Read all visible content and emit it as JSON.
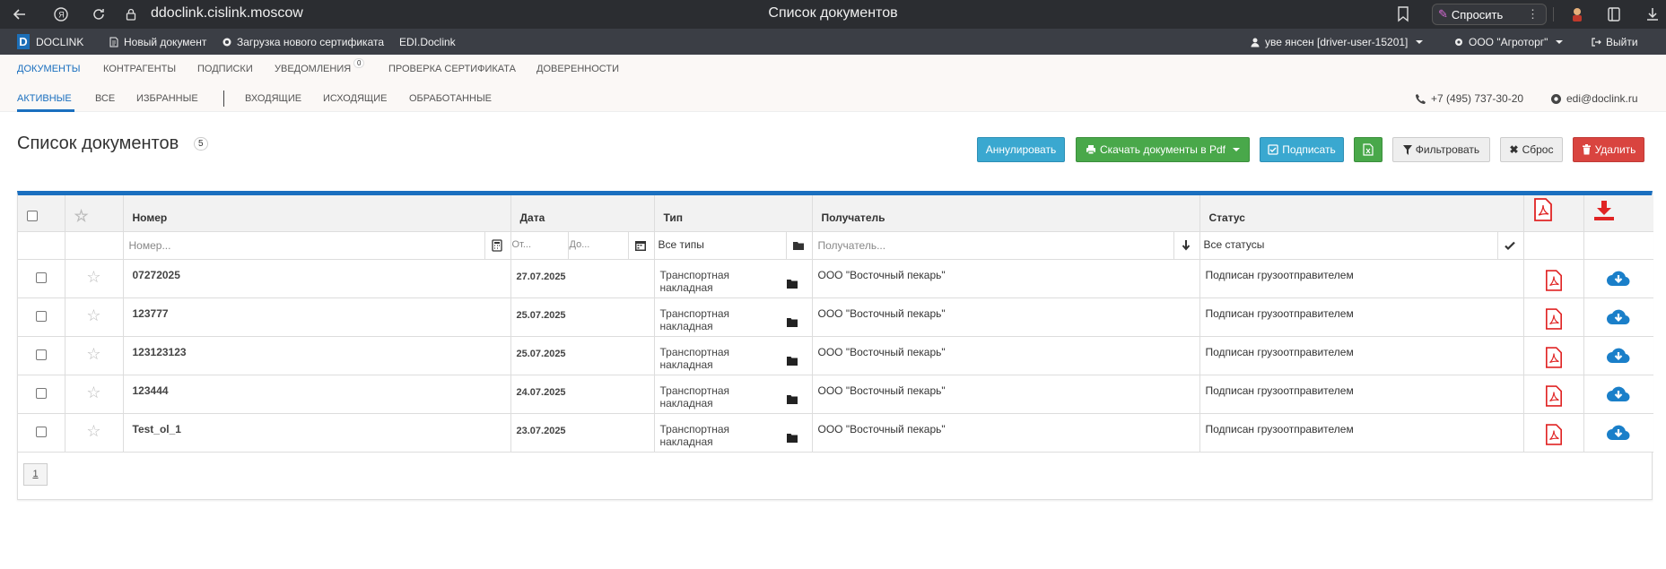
{
  "browser": {
    "url": "ddoclink.cislink.moscow",
    "tab_title": "Список документов",
    "ask_label": "Спросить"
  },
  "appbar": {
    "brand": "DOCLINK",
    "new_doc": "Новый документ",
    "upload_cert": "Загрузка нового сертификата",
    "edi": "EDI.Doclink",
    "user": "уве янсен [driver-user-15201]",
    "org": "ООО \"Агроторг\"",
    "logout": "Выйти"
  },
  "mainnav": {
    "items": [
      "ДОКУМЕНТЫ",
      "КОНТРАГЕНТЫ",
      "ПОДПИСКИ",
      "УВЕДОМЛЕНИЯ",
      "ПРОВЕРКА СЕРТИФИКАТА",
      "ДОВЕРЕННОСТИ"
    ],
    "notif_count": "0"
  },
  "subnav": {
    "items": [
      "АКТИВНЫЕ",
      "ВСЕ",
      "ИЗБРАННЫЕ",
      "ВХОДЯЩИЕ",
      "ИСХОДЯЩИЕ",
      "ОБРАБОТАННЫЕ"
    ],
    "phone": "+7 (495) 737-30-20",
    "email": "edi@doclink.ru"
  },
  "page": {
    "title": "Список документов",
    "count": "5"
  },
  "toolbar": {
    "annul": "Аннулировать",
    "download_pdf": "Скачать документы в Pdf",
    "sign": "Подписать",
    "filter": "Фильтровать",
    "reset": "Сброс",
    "delete": "Удалить"
  },
  "table": {
    "columns": {
      "number": "Номер",
      "date": "Дата",
      "type": "Тип",
      "recipient": "Получатель",
      "status": "Статус"
    },
    "filters": {
      "number_placeholder": "Номер...",
      "date_from": "От...",
      "date_to": "До...",
      "type_value": "Все типы",
      "recipient_placeholder": "Получатель...",
      "status_value": "Все статусы"
    },
    "rows": [
      {
        "number": "07272025",
        "date": "27.07.2025",
        "type": "Транспортная накладная",
        "recipient": "ООО \"Восточный пекарь\"",
        "status": "Подписан грузоотправителем"
      },
      {
        "number": "123777",
        "date": "25.07.2025",
        "type": "Транспортная накладная",
        "recipient": "ООО \"Восточный пекарь\"",
        "status": "Подписан грузоотправителем"
      },
      {
        "number": "123123123",
        "date": "25.07.2025",
        "type": "Транспортная накладная",
        "recipient": "ООО \"Восточный пекарь\"",
        "status": "Подписан грузоотправителем"
      },
      {
        "number": "123444",
        "date": "24.07.2025",
        "type": "Транспортная накладная",
        "recipient": "ООО \"Восточный пекарь\"",
        "status": "Подписан грузоотправителем"
      },
      {
        "number": "Test_ol_1",
        "date": "23.07.2025",
        "type": "Транспортная накладная",
        "recipient": "ООО \"Восточный пекарь\"",
        "status": "Подписан грузоотправителем"
      }
    ]
  },
  "pagination": {
    "current": "1"
  },
  "colors": {
    "accent": "#1a6fbf",
    "pdf_red": "#e02424",
    "download_blue": "#1a7fc9"
  }
}
